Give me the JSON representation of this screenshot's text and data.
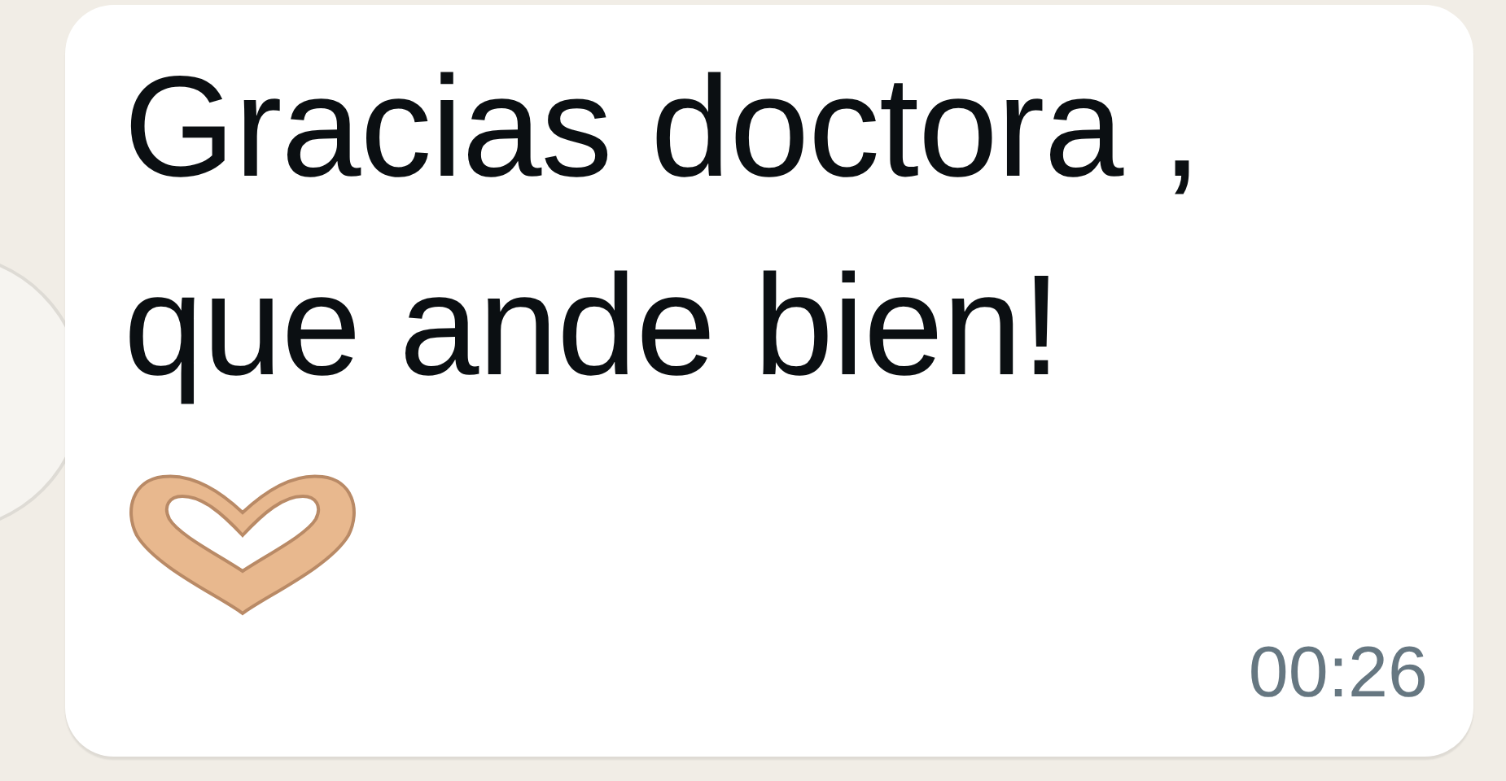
{
  "message": {
    "text": "Gracias doctora , que ande bien!",
    "time": "00:26"
  }
}
